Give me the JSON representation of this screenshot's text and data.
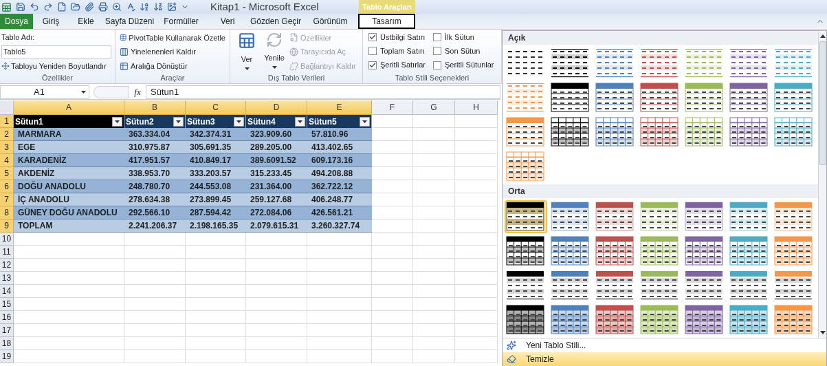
{
  "window": {
    "title": "Kitap1 - Microsoft Excel"
  },
  "contextual_tab": "Tablo Araçları",
  "tabs": [
    {
      "label": "Dosya",
      "selected": false,
      "kind": "file"
    },
    {
      "label": "Giriş",
      "selected": false,
      "kind": "tab"
    },
    {
      "label": "Ekle",
      "selected": false,
      "kind": "tab"
    },
    {
      "label": "Sayfa Düzeni",
      "selected": false,
      "kind": "tab"
    },
    {
      "label": "Formüller",
      "selected": false,
      "kind": "tab"
    },
    {
      "label": "Veri",
      "selected": false,
      "kind": "tab"
    },
    {
      "label": "Gözden Geçir",
      "selected": false,
      "kind": "tab"
    },
    {
      "label": "Görünüm",
      "selected": false,
      "kind": "tab"
    },
    {
      "label": "Tasarım",
      "selected": true,
      "kind": "tab"
    }
  ],
  "ribbon": {
    "properties": {
      "title": "Özellikler",
      "name_label": "Tablo Adı:",
      "name_value": "Tablo5",
      "resize_button": "Tabloyu Yeniden Boyutlandır"
    },
    "tools": {
      "title": "Araçlar",
      "buttons": [
        "PivotTable Kullanarak Özetle",
        "Yinelenenleri Kaldır",
        "Aralığa Dönüştür"
      ]
    },
    "external": {
      "title": "Dış Tablo Verileri",
      "large_buttons": [
        {
          "label": "Ver",
          "disabled": false
        },
        {
          "label": "Yenile",
          "disabled": false
        }
      ],
      "small_buttons": [
        {
          "label": "Özellikler",
          "disabled": true
        },
        {
          "label": "Tarayıcıda Aç",
          "disabled": true
        },
        {
          "label": "Bağlantıyı Kaldır",
          "disabled": true
        }
      ]
    },
    "style_options": {
      "title": "Tablo Stili Seçenekleri",
      "options": [
        {
          "label": "Üstbilgi Satırı",
          "checked": true
        },
        {
          "label": "Toplam Satırı",
          "checked": false
        },
        {
          "label": "Şeritli Satırlar",
          "checked": true
        },
        {
          "label": "İlk Sütun",
          "checked": false
        },
        {
          "label": "Son Sütun",
          "checked": false
        },
        {
          "label": "Şeritli Sütunlar",
          "checked": false
        }
      ]
    }
  },
  "formula_bar": {
    "name_box": "A1",
    "function_button": "fx",
    "formula": "Sütun1"
  },
  "sheet": {
    "columns": [
      {
        "label": "A",
        "selected": true
      },
      {
        "label": "B",
        "selected": true
      },
      {
        "label": "C",
        "selected": true
      },
      {
        "label": "D",
        "selected": true
      },
      {
        "label": "E",
        "selected": true
      },
      {
        "label": "F",
        "selected": false
      },
      {
        "label": "G",
        "selected": false
      },
      {
        "label": "H",
        "selected": false
      }
    ],
    "rows": [
      {
        "number": "1",
        "selected": true,
        "kind": "header",
        "cells": [
          {
            "text": "Sütun1",
            "active": true
          },
          {
            "text": "Sütun2",
            "active": false
          },
          {
            "text": "Sütun3",
            "active": false
          },
          {
            "text": "Sütun4",
            "active": false
          },
          {
            "text": "Sütun5",
            "active": false
          }
        ]
      },
      {
        "number": "2",
        "selected": true,
        "kind": "data",
        "cells": [
          "MARMARA",
          "363.334.04",
          "342.374.31",
          "323.909.60",
          "57.810.96"
        ]
      },
      {
        "number": "3",
        "selected": true,
        "kind": "data",
        "cells": [
          "EGE",
          "310.975.87",
          "305.691.35",
          "289.205.00",
          "413.402.65"
        ]
      },
      {
        "number": "4",
        "selected": true,
        "kind": "data",
        "cells": [
          "KARADENİZ",
          "417.951.57",
          "410.849.17",
          "389.6091.52",
          "609.173.16"
        ]
      },
      {
        "number": "5",
        "selected": true,
        "kind": "data",
        "cells": [
          "AKDENİZ",
          "338.953.70",
          "333.203.57",
          "315.233.45",
          "494.208.88"
        ]
      },
      {
        "number": "6",
        "selected": true,
        "kind": "data",
        "cells": [
          "DOĞU ANADOLU",
          "248.780.70",
          "244.553.08",
          "231.364.00",
          "362.722.12"
        ]
      },
      {
        "number": "7",
        "selected": true,
        "kind": "data",
        "cells": [
          "İÇ ANADOLU",
          "278.634.38",
          "273.899.45",
          "259.127.68",
          "406.248.77"
        ]
      },
      {
        "number": "8",
        "selected": true,
        "kind": "data",
        "cells": [
          "GÜNEY DOĞU ANADOLU",
          "292.566.10",
          "287.594.42",
          "272.084.06",
          "426.561.21"
        ]
      },
      {
        "number": "9",
        "selected": true,
        "kind": "data",
        "cells": [
          "TOPLAM",
          "2.241.206.37",
          "2.198.165.35",
          "2.079.615.31",
          "3.260.327.74"
        ]
      },
      {
        "number": "10",
        "selected": false,
        "kind": "empty"
      },
      {
        "number": "11",
        "selected": false,
        "kind": "empty"
      },
      {
        "number": "12",
        "selected": false,
        "kind": "empty"
      },
      {
        "number": "13",
        "selected": false,
        "kind": "empty"
      },
      {
        "number": "14",
        "selected": false,
        "kind": "empty"
      },
      {
        "number": "15",
        "selected": false,
        "kind": "empty"
      },
      {
        "number": "16",
        "selected": false,
        "kind": "empty"
      },
      {
        "number": "17",
        "selected": false,
        "kind": "empty"
      },
      {
        "number": "18",
        "selected": false,
        "kind": "empty"
      },
      {
        "number": "19",
        "selected": false,
        "kind": "empty"
      }
    ]
  },
  "style_gallery": {
    "sections": [
      {
        "title": "Açık",
        "swatches": [
          {
            "kind": "plain",
            "color": "#000000",
            "selected": false
          },
          {
            "kind": "light-lines",
            "color": "#000000",
            "selected": false
          },
          {
            "kind": "light-lines",
            "color": "#4f81bd",
            "selected": false
          },
          {
            "kind": "light-lines",
            "color": "#c0504d",
            "selected": false
          },
          {
            "kind": "light-lines",
            "color": "#9bbb59",
            "selected": false
          },
          {
            "kind": "light-lines",
            "color": "#8064a2",
            "selected": false
          },
          {
            "kind": "light-lines",
            "color": "#4bacc6",
            "selected": false
          },
          {
            "kind": "light-lines",
            "color": "#f79646",
            "selected": false
          },
          {
            "kind": "header",
            "color": "#000000",
            "selected": false
          },
          {
            "kind": "header",
            "color": "#4f81bd",
            "selected": false
          },
          {
            "kind": "header",
            "color": "#c0504d",
            "selected": false
          },
          {
            "kind": "header",
            "color": "#9bbb59",
            "selected": false
          },
          {
            "kind": "header",
            "color": "#8064a2",
            "selected": false
          },
          {
            "kind": "header",
            "color": "#4bacc6",
            "selected": false
          },
          {
            "kind": "header",
            "color": "#f79646",
            "selected": false
          },
          {
            "kind": "grid",
            "color": "#000000",
            "selected": false
          },
          {
            "kind": "grid",
            "color": "#4f81bd",
            "selected": false
          },
          {
            "kind": "grid",
            "color": "#c0504d",
            "selected": false
          },
          {
            "kind": "grid",
            "color": "#9bbb59",
            "selected": false
          },
          {
            "kind": "grid",
            "color": "#8064a2",
            "selected": false
          },
          {
            "kind": "grid",
            "color": "#4bacc6",
            "selected": false
          },
          {
            "kind": "grid",
            "color": "#f79646",
            "selected": false
          }
        ]
      },
      {
        "title": "Orta",
        "swatches": [
          {
            "kind": "banded",
            "color": "#000000",
            "selected": true
          },
          {
            "kind": "banded",
            "color": "#4f81bd",
            "selected": false
          },
          {
            "kind": "banded",
            "color": "#c0504d",
            "selected": false
          },
          {
            "kind": "banded",
            "color": "#9bbb59",
            "selected": false
          },
          {
            "kind": "banded",
            "color": "#8064a2",
            "selected": false
          },
          {
            "kind": "banded",
            "color": "#4bacc6",
            "selected": false
          },
          {
            "kind": "banded",
            "color": "#f79646",
            "selected": false
          },
          {
            "kind": "banded-grid",
            "color": "#000000",
            "selected": false
          },
          {
            "kind": "banded-grid",
            "color": "#4f81bd",
            "selected": false
          },
          {
            "kind": "banded-grid",
            "color": "#c0504d",
            "selected": false
          },
          {
            "kind": "banded-grid",
            "color": "#9bbb59",
            "selected": false
          },
          {
            "kind": "banded-grid",
            "color": "#8064a2",
            "selected": false
          },
          {
            "kind": "banded-grid",
            "color": "#4bacc6",
            "selected": false
          },
          {
            "kind": "banded-grid",
            "color": "#f79646",
            "selected": false
          },
          {
            "kind": "header-line",
            "color": "#000000",
            "selected": false
          },
          {
            "kind": "header-line",
            "color": "#4f81bd",
            "selected": false
          },
          {
            "kind": "header-line",
            "color": "#c0504d",
            "selected": false
          },
          {
            "kind": "header-line",
            "color": "#9bbb59",
            "selected": false
          },
          {
            "kind": "header-line",
            "color": "#8064a2",
            "selected": false
          },
          {
            "kind": "header-line",
            "color": "#4bacc6",
            "selected": false
          },
          {
            "kind": "header-line",
            "color": "#f79646",
            "selected": false
          },
          {
            "kind": "grid-filled",
            "color": "#000000",
            "selected": false
          },
          {
            "kind": "grid-filled",
            "color": "#4f81bd",
            "selected": false
          },
          {
            "kind": "grid-filled",
            "color": "#c0504d",
            "selected": false
          },
          {
            "kind": "grid-filled",
            "color": "#9bbb59",
            "selected": false
          },
          {
            "kind": "grid-filled",
            "color": "#8064a2",
            "selected": false
          },
          {
            "kind": "grid-filled",
            "color": "#4bacc6",
            "selected": false
          },
          {
            "kind": "grid-filled",
            "color": "#f79646",
            "selected": false
          }
        ]
      }
    ],
    "menu": [
      {
        "label": "Yeni Tablo Stili...",
        "highlighted": false,
        "kind": "new"
      },
      {
        "label": "Temizle",
        "highlighted": true,
        "kind": "clear"
      }
    ]
  }
}
